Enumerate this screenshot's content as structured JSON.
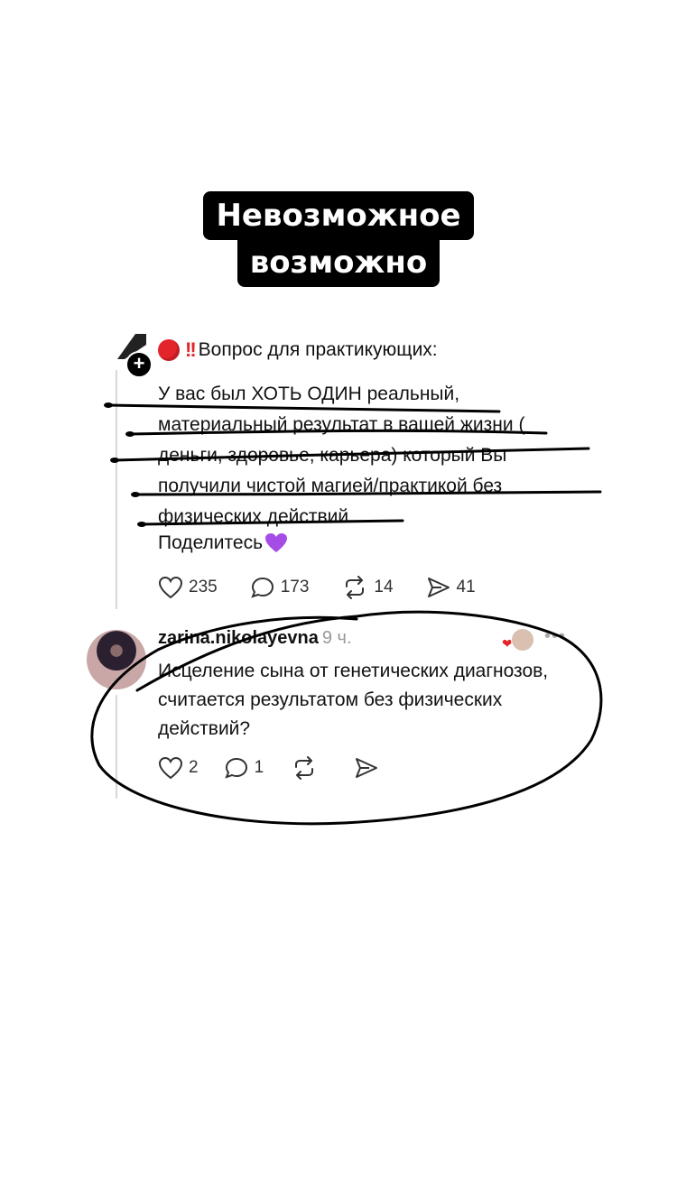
{
  "title": {
    "line1": "Невозможное",
    "line2": "возможно"
  },
  "post": {
    "header": "Вопрос для практикующих:",
    "body": "У вас был ХОТЬ ОДИН реальный, материальный результат в вашей жизни ( деньги, здоровье, карьера) который Вы получили чистой магией/практикой без физических действий.",
    "share": "Поделитесь",
    "likes": "235",
    "comments": "173",
    "reposts": "14",
    "shares": "41"
  },
  "reply": {
    "username": "zarina.nikolayevna",
    "time": "9 ч.",
    "body": "Исцеление сына от генетических диагнозов, считается результатом без физических действий?",
    "likes": "2",
    "comments": "1"
  },
  "icons": [
    "red-circle-icon",
    "double-exclamation-icon",
    "purple-heart-icon",
    "heart-icon",
    "comment-icon",
    "repost-icon",
    "send-icon",
    "more-icon"
  ]
}
